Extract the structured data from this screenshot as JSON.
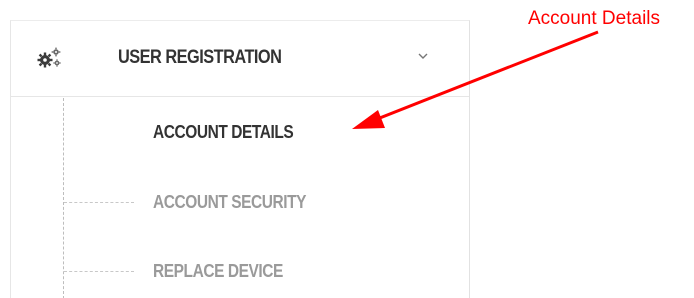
{
  "nav": {
    "section_label": "USER REGISTRATION",
    "items": [
      {
        "label": "ACCOUNT DETAILS",
        "state": "active"
      },
      {
        "label": "ACCOUNT SECURITY",
        "state": "inactive"
      },
      {
        "label": "REPLACE DEVICE",
        "state": "inactive"
      }
    ],
    "section_icon": "gears-icon",
    "expand_icon": "chevron-down-icon"
  },
  "annotation": {
    "label": "Account Details",
    "color": "#ff0000"
  },
  "colors": {
    "active_text": "#333333",
    "inactive_text": "#9a9a9a",
    "border": "#e6e6e6"
  }
}
